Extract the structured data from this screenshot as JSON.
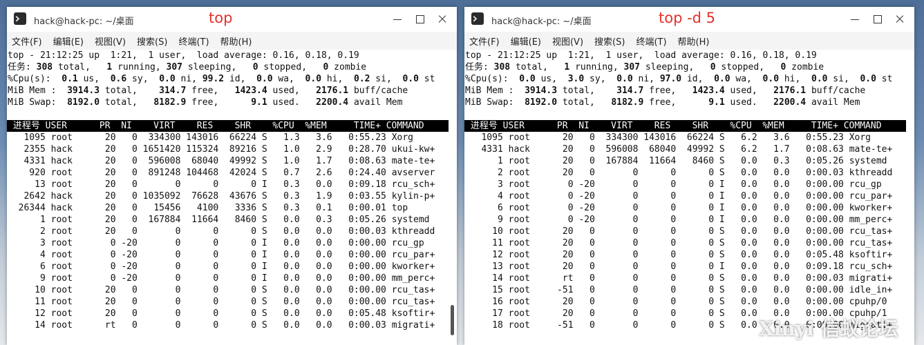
{
  "left": {
    "title": "hack@hack-pc: ~/桌面",
    "annotation": "top",
    "menu": [
      "文件(F)",
      "编辑(E)",
      "视图(V)",
      "搜索(S)",
      "终端(T)",
      "帮助(H)"
    ],
    "summary": {
      "line1": "top - 21:12:25 up  1:21,  1 user,  load average: 0.16, 0.18, 0.19",
      "tasks": [
        "任务: ",
        "308",
        " total,   ",
        "1",
        " running, ",
        "307",
        " sleeping,   ",
        "0",
        " stopped,   ",
        "0",
        " zombie"
      ],
      "cpu": [
        "%Cpu(s):  ",
        "0.1",
        " us,  ",
        "0.6",
        " sy,  ",
        "0.0",
        " ni, ",
        "99.2",
        " id,  ",
        "0.0",
        " wa,  ",
        "0.0",
        " hi,  ",
        "0.2",
        " si,  ",
        "0.0",
        " st"
      ],
      "mem": [
        "MiB Mem :  ",
        "3914.3",
        " total,    ",
        "314.7",
        " free,   ",
        "1423.4",
        " used,   ",
        "2176.1",
        " buff/cache"
      ],
      "swap": [
        "MiB Swap:  ",
        "8192.0",
        " total,   ",
        "8182.9",
        " free,      ",
        "9.1",
        " used.   ",
        "2200.4",
        " avail Mem"
      ]
    },
    "header": " 进程号 USER      PR  NI    VIRT    RES    SHR    %CPU  %MEM     TIME+ COMMAND",
    "rows": [
      "   1095 root      20   0  334300 143016  66224 S   1.3   3.6   0:55.23 Xorg",
      "   2355 hack      20   0 1651420 115324  89216 S   1.0   2.9   0:28.70 ukui-kw+",
      "   4331 hack      20   0  596008  68040  49992 S   1.0   1.7   0:08.63 mate-te+",
      "    920 root      20   0  891248 104468  42024 S   0.7   2.6   0:24.40 avserver",
      "     13 root      20   0       0      0      0 I   0.3   0.0   0:09.18 rcu_sch+",
      "   2642 hack      20   0 1035092  76628  43676 S   0.3   1.9   0:03.55 kylin-p+",
      "  26344 hack      20   0   15456   4100   3336 S   0.3   0.1   0:00.01 top",
      "      1 root      20   0  167884  11664   8460 S   0.0   0.3   0:05.26 systemd",
      "      2 root      20   0       0      0      0 S   0.0   0.0   0:00.03 kthreadd",
      "      3 root       0 -20       0      0      0 I   0.0   0.0   0:00.00 rcu_gp",
      "      4 root       0 -20       0      0      0 I   0.0   0.0   0:00.00 rcu_par+",
      "      6 root       0 -20       0      0      0 I   0.0   0.0   0:00.00 kworker+",
      "      9 root       0 -20       0      0      0 I   0.0   0.0   0:00.00 mm_perc+",
      "     10 root      20   0       0      0      0 S   0.0   0.0   0:00.00 rcu_tas+",
      "     11 root      20   0       0      0      0 S   0.0   0.0   0:00.00 rcu_tas+",
      "     12 root      20   0       0      0      0 S   0.0   0.0   0:05.48 ksoftir+",
      "     14 root      rt   0       0      0      0 S   0.0   0.0   0:00.03 migrati+"
    ]
  },
  "right": {
    "title": "hack@hack-pc: ~/桌面",
    "annotation": "top -d 5",
    "menu": [
      "文件(F)",
      "编辑(E)",
      "视图(V)",
      "搜索(S)",
      "终端(T)",
      "帮助(H)"
    ],
    "summary": {
      "line1": "top - 21:12:25 up  1:21,  1 user,  load average: 0.16, 0.18, 0.19",
      "tasks": [
        "任务: ",
        "308",
        " total,   ",
        "1",
        " running, ",
        "307",
        " sleeping,   ",
        "0",
        " stopped,   ",
        "0",
        " zombie"
      ],
      "cpu": [
        "%Cpu(s):  ",
        "0.0",
        " us,  ",
        "3.0",
        " sy,  ",
        "0.0",
        " ni, ",
        "97.0",
        " id,  ",
        "0.0",
        " wa,  ",
        "0.0",
        " hi,  ",
        "0.0",
        " si,  ",
        "0.0",
        " st"
      ],
      "mem": [
        "MiB Mem :  ",
        "3914.3",
        " total,    ",
        "314.7",
        " free,   ",
        "1423.4",
        " used,   ",
        "2176.1",
        " buff/cache"
      ],
      "swap": [
        "MiB Swap:  ",
        "8192.0",
        " total,   ",
        "8182.9",
        " free,      ",
        "9.1",
        " used.   ",
        "2200.4",
        " avail Mem"
      ]
    },
    "header": " 进程号 USER      PR  NI    VIRT    RES    SHR    %CPU  %MEM     TIME+ COMMAND",
    "rows": [
      "   1095 root      20   0  334300 143016  66224 S   6.2   3.6   0:55.23 Xorg",
      "   4331 hack      20   0  596008  68040  49992 S   6.2   1.7   0:08.63 mate-te+",
      "      1 root      20   0  167884  11664   8460 S   0.0   0.3   0:05.26 systemd",
      "      2 root      20   0       0      0      0 S   0.0   0.0   0:00.03 kthreadd",
      "      3 root       0 -20       0      0      0 I   0.0   0.0   0:00.00 rcu_gp",
      "      4 root       0 -20       0      0      0 I   0.0   0.0   0:00.00 rcu_par+",
      "      6 root       0 -20       0      0      0 I   0.0   0.0   0:00.00 kworker+",
      "      9 root       0 -20       0      0      0 I   0.0   0.0   0:00.00 mm_perc+",
      "     10 root      20   0       0      0      0 S   0.0   0.0   0:00.00 rcu_tas+",
      "     11 root      20   0       0      0      0 S   0.0   0.0   0:00.00 rcu_tas+",
      "     12 root      20   0       0      0      0 S   0.0   0.0   0:05.48 ksoftir+",
      "     13 root      20   0       0      0      0 I   0.0   0.0   0:09.18 rcu_sch+",
      "     14 root      rt   0       0      0      0 S   0.0   0.0   0:00.03 migrati+",
      "     15 root     -51   0       0      0      0 S   0.0   0.0   0:00.00 idle_in+",
      "     16 root      20   0       0      0      0 S   0.0   0.0   0:00.00 cpuhp/0",
      "     17 root      20   0       0      0      0 S   0.0   0.0   0:00.00 cpuhp/1",
      "     18 root     -51   0       0      0      0 S   0.0   0.0   0:00.00 migrati+"
    ]
  },
  "watermark": "Xinyi 信蚁论坛"
}
